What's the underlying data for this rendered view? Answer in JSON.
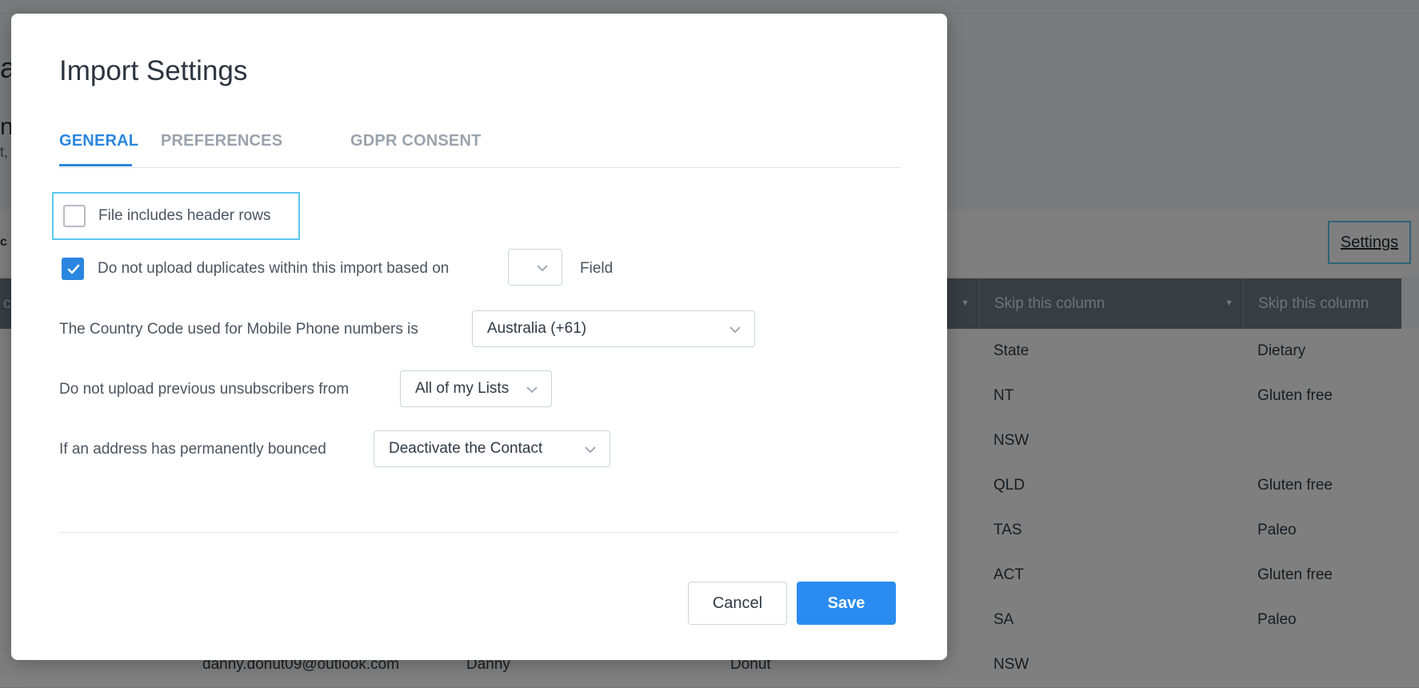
{
  "background": {
    "settings_link": "Settings",
    "table_headers": [
      {
        "label": "Skip this column"
      },
      {
        "label": "Skip this column"
      }
    ],
    "rows": [
      {
        "col3": "State",
        "col4": "Dietary"
      },
      {
        "col3": "NT",
        "col4": "Gluten free"
      },
      {
        "col3": "NSW",
        "col4": ""
      },
      {
        "col3": "QLD",
        "col4": "Gluten free"
      },
      {
        "col3": "TAS",
        "col4": "Paleo"
      },
      {
        "col3": "ACT",
        "col4": "Gluten free"
      },
      {
        "col3": "SA",
        "col4": "Paleo"
      },
      {
        "col0": "danny.donut09@outlook.com",
        "col1": "Danny",
        "col2": "Donut",
        "col3": "NSW",
        "col4": ""
      }
    ]
  },
  "modal": {
    "title": "Import Settings",
    "tabs": [
      {
        "label": "GENERAL",
        "active": true
      },
      {
        "label": "PREFERENCES",
        "active": false
      },
      {
        "label": "GDPR CONSENT",
        "active": false
      }
    ],
    "header_rows": {
      "label": "File includes header rows",
      "checked": false
    },
    "duplicates": {
      "label": "Do not upload duplicates within this import based on",
      "checked": true,
      "field_value": "",
      "suffix": "Field"
    },
    "country_code": {
      "label": "The Country Code used for Mobile Phone numbers is",
      "value": "Australia (+61)"
    },
    "unsubscribers": {
      "label": "Do not upload previous unsubscribers from",
      "value": "All of my Lists"
    },
    "bounced": {
      "label": "If an address has permanently bounced",
      "value": "Deactivate the Contact"
    },
    "buttons": {
      "cancel": "Cancel",
      "save": "Save"
    }
  },
  "colors": {
    "accent": "#2a86e0",
    "highlight": "#5bc8f0",
    "overlay": "rgba(0,0,0,0.5)"
  }
}
